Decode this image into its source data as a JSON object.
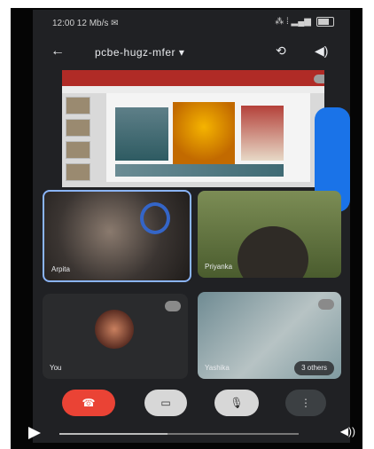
{
  "status_bar": {
    "time": "12:00 12 Mb/s ✉",
    "signal": "⁂ ⁞ ▂▄▆"
  },
  "header": {
    "back_icon": "arrow-left-icon",
    "meeting_code": "pcbe-hugz-mfer ▾",
    "camera_switch_icon": "camera-flip-icon",
    "speaker_icon": "speaker-icon"
  },
  "presentation": {
    "self_label": ""
  },
  "participants": [
    {
      "name": "Arpita",
      "label_visible": "Arpita"
    },
    {
      "name": "Priyanka",
      "label_visible": "Priyanka"
    },
    {
      "name": "You",
      "label_visible": "You"
    },
    {
      "name": "Yashika",
      "label_visible": "Yashika"
    }
  ],
  "others_badge": "3 others",
  "controls": {
    "end_call_icon": "☎",
    "camera_icon": "▭",
    "mic_icon": "🎙",
    "more_icon": "⋮"
  },
  "video_player": {
    "progress": 0.45,
    "volume_icon": "◀))"
  }
}
